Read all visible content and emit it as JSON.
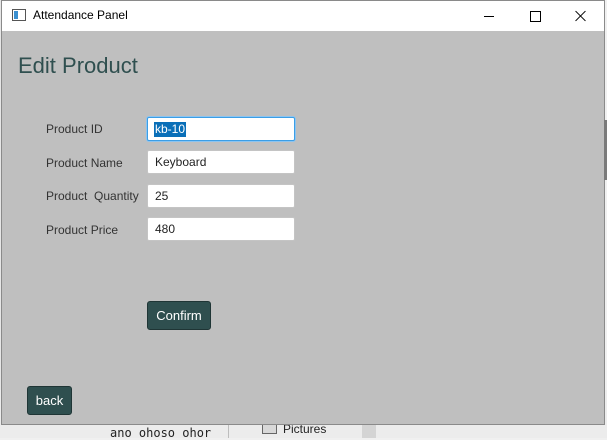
{
  "background": {
    "code_text": "ano ohoso ohor",
    "folder_label": "Pictures"
  },
  "window": {
    "title": "Attendance Panel",
    "controls": {
      "minimize_icon": "minimize-icon",
      "maximize_icon": "maximize-icon",
      "close_icon": "close-icon"
    }
  },
  "form": {
    "heading": "Edit Product",
    "fields": [
      {
        "label": "Product ID",
        "value": "kb-10",
        "selected": true
      },
      {
        "label": "Product Name",
        "value": "Keyboard"
      },
      {
        "label": "Product  Quantity",
        "value": "25"
      },
      {
        "label": "Product Price",
        "value": "480"
      }
    ],
    "confirm_label": "Confirm",
    "back_label": "back"
  },
  "colors": {
    "panel_bg": "#bfbfbf",
    "accent_dark": "#2f4f4f",
    "focus_blue": "#3b9ee6",
    "selection_blue": "#0a6fb8"
  }
}
